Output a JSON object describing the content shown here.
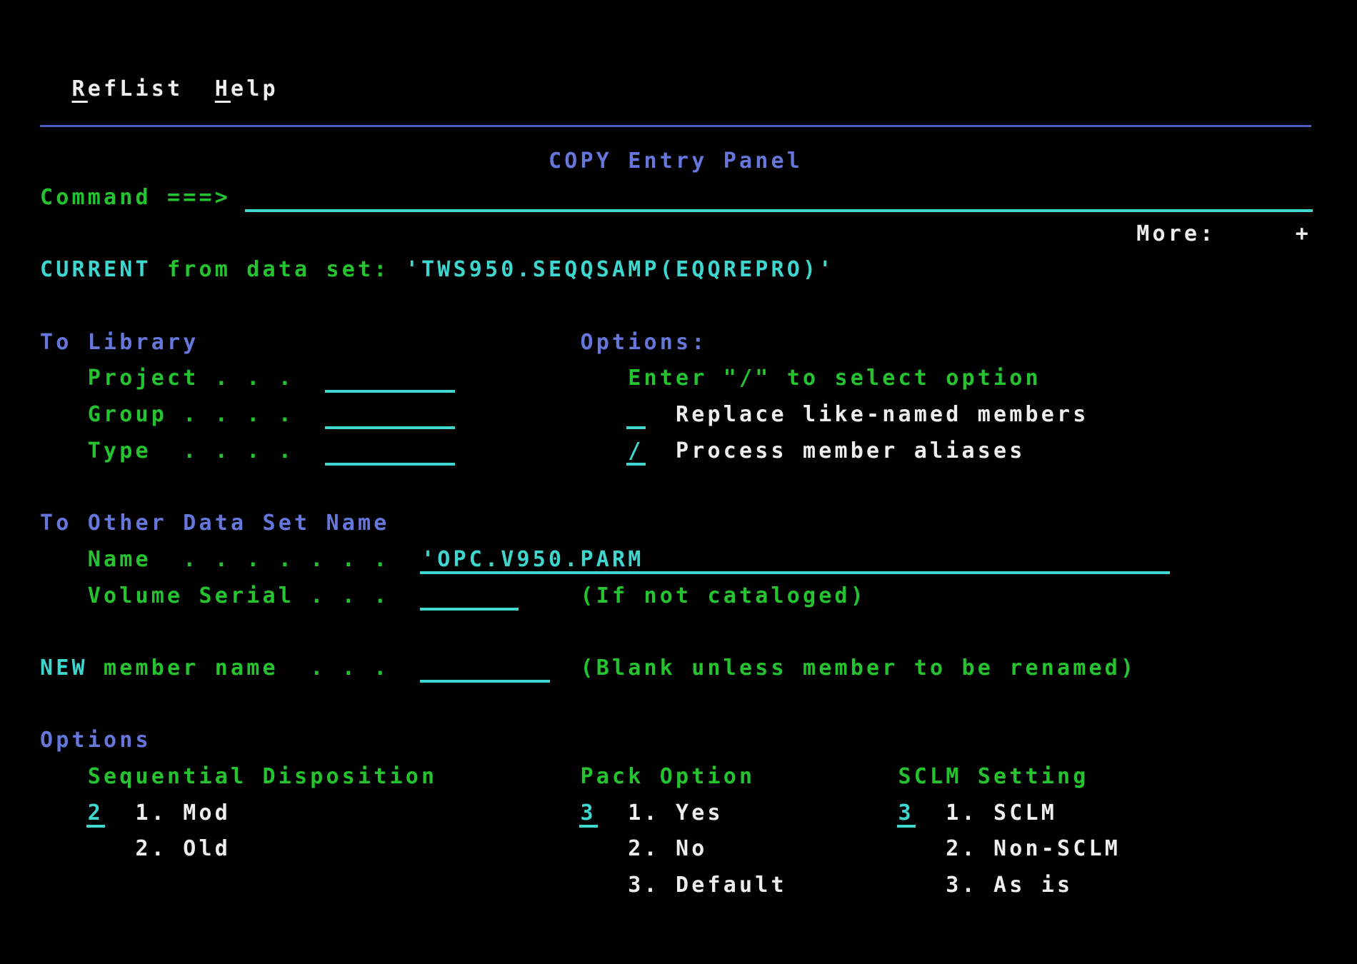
{
  "palette": {
    "background": "#000000",
    "green": "#25c32f",
    "cyan": "#40d6d0",
    "blue": "#6577da",
    "white": "#ededed",
    "divider_blue": "#4d5ec2"
  },
  "screen": {
    "rows": [
      {
        "r": 1,
        "segments": [
          {
            "col": 2,
            "color": "white",
            "name": "menu-reflist",
            "interactable": true,
            "u": "R",
            "rest": "efList"
          },
          {
            "col": 11,
            "color": "white",
            "name": "menu-help",
            "interactable": true,
            "u": "H",
            "rest": "elp"
          }
        ]
      },
      {
        "r": 3,
        "segments": [
          {
            "col": 32,
            "color": "blue",
            "name": "panel-title",
            "interactable": false,
            "text": "COPY Entry Panel"
          }
        ]
      },
      {
        "r": 4,
        "segments": [
          {
            "col": 0,
            "color": "green",
            "name": "command-label",
            "interactable": false,
            "text": "Command ===>"
          }
        ]
      },
      {
        "r": 5,
        "segments": [
          {
            "col": 69,
            "color": "white",
            "name": "more-indicator",
            "interactable": false,
            "text": "More:"
          },
          {
            "col": 79,
            "color": "white",
            "name": "more-plus",
            "interactable": true,
            "text": "+"
          }
        ]
      },
      {
        "r": 6,
        "segments": [
          {
            "col": 0,
            "color": "cyan",
            "name": "current-label",
            "interactable": false,
            "text": "CURRENT"
          },
          {
            "col": 8,
            "color": "green",
            "name": "from-dataset-label",
            "interactable": false,
            "text": "from data set:"
          },
          {
            "col": 23,
            "color": "cyan",
            "name": "current-dataset-value",
            "interactable": false,
            "text": "'TWS950.SEQQSAMP(EQQREPRO)'"
          }
        ]
      },
      {
        "r": 8,
        "segments": [
          {
            "col": 0,
            "color": "blue",
            "name": "to-library-heading",
            "interactable": false,
            "text": "To Library"
          },
          {
            "col": 34,
            "color": "blue",
            "name": "options-heading",
            "interactable": false,
            "text": "Options:"
          }
        ]
      },
      {
        "r": 9,
        "segments": [
          {
            "col": 3,
            "color": "green",
            "name": "project-label",
            "interactable": false,
            "text": "Project . . ."
          },
          {
            "col": 37,
            "color": "green",
            "name": "select-option-hint",
            "interactable": false,
            "text": "Enter \"/\" to select option"
          }
        ]
      },
      {
        "r": 10,
        "segments": [
          {
            "col": 3,
            "color": "green",
            "name": "group-label",
            "interactable": false,
            "text": "Group . . . ."
          },
          {
            "col": 40,
            "color": "white",
            "name": "replace-option-label",
            "interactable": false,
            "text": "Replace like-named members"
          }
        ]
      },
      {
        "r": 11,
        "segments": [
          {
            "col": 3,
            "color": "green",
            "name": "type-label",
            "interactable": false,
            "text": "Type  . . . ."
          },
          {
            "col": 40,
            "color": "white",
            "name": "aliases-option-label",
            "interactable": false,
            "text": "Process member aliases"
          }
        ]
      },
      {
        "r": 13,
        "segments": [
          {
            "col": 0,
            "color": "blue",
            "name": "to-other-dataset-heading",
            "interactable": false,
            "text": "To Other Data Set Name"
          }
        ]
      },
      {
        "r": 14,
        "segments": [
          {
            "col": 3,
            "color": "green",
            "name": "name-label",
            "interactable": false,
            "text": "Name  . . . . . . ."
          }
        ]
      },
      {
        "r": 15,
        "segments": [
          {
            "col": 3,
            "color": "green",
            "name": "volume-serial-label",
            "interactable": false,
            "text": "Volume Serial . . ."
          },
          {
            "col": 34,
            "color": "green",
            "name": "if-not-cataloged-note",
            "interactable": false,
            "text": "(If not cataloged)"
          }
        ]
      },
      {
        "r": 17,
        "segments": [
          {
            "col": 0,
            "color": "cyan",
            "name": "new-label",
            "interactable": false,
            "text": "NEW"
          },
          {
            "col": 4,
            "color": "green",
            "name": "member-name-label",
            "interactable": false,
            "text": "member name  . . ."
          },
          {
            "col": 34,
            "color": "green",
            "name": "rename-note",
            "interactable": false,
            "text": "(Blank unless member to be renamed)"
          }
        ]
      },
      {
        "r": 19,
        "segments": [
          {
            "col": 0,
            "color": "blue",
            "name": "options-section-heading",
            "interactable": false,
            "text": "Options"
          }
        ]
      },
      {
        "r": 20,
        "segments": [
          {
            "col": 3,
            "color": "green",
            "name": "sequential-disposition-label",
            "interactable": false,
            "text": "Sequential Disposition"
          },
          {
            "col": 34,
            "color": "green",
            "name": "pack-option-label",
            "interactable": false,
            "text": "Pack Option"
          },
          {
            "col": 54,
            "color": "green",
            "name": "sclm-setting-label",
            "interactable": false,
            "text": "SCLM Setting"
          }
        ]
      },
      {
        "r": 21,
        "segments": [
          {
            "col": 6,
            "color": "white",
            "name": "seq-disp-choice-1",
            "interactable": false,
            "text": "1. Mod"
          },
          {
            "col": 37,
            "color": "white",
            "name": "pack-choice-1",
            "interactable": false,
            "text": "1. Yes"
          },
          {
            "col": 57,
            "color": "white",
            "name": "sclm-choice-1",
            "interactable": false,
            "text": "1. SCLM"
          }
        ]
      },
      {
        "r": 22,
        "segments": [
          {
            "col": 6,
            "color": "white",
            "name": "seq-disp-choice-2",
            "interactable": false,
            "text": "2. Old"
          },
          {
            "col": 37,
            "color": "white",
            "name": "pack-choice-2",
            "interactable": false,
            "text": "2. No"
          },
          {
            "col": 57,
            "color": "white",
            "name": "sclm-choice-2",
            "interactable": false,
            "text": "2. Non-SCLM"
          }
        ]
      },
      {
        "r": 23,
        "segments": [
          {
            "col": 37,
            "color": "white",
            "name": "pack-choice-3",
            "interactable": false,
            "text": "3. Default"
          },
          {
            "col": 57,
            "color": "white",
            "name": "sclm-choice-3",
            "interactable": false,
            "text": "3. As is"
          }
        ]
      }
    ],
    "fields": [
      {
        "r": 4,
        "col": 13,
        "width": 67,
        "text": "",
        "name": "command-input"
      },
      {
        "r": 9,
        "col": 18,
        "width": 8,
        "text": "",
        "name": "project-input"
      },
      {
        "r": 10,
        "col": 18,
        "width": 8,
        "text": "",
        "name": "group-input"
      },
      {
        "r": 11,
        "col": 18,
        "width": 8,
        "text": "",
        "name": "type-input"
      },
      {
        "r": 10,
        "col": 37,
        "width": 1,
        "text": "",
        "name": "replace-members-input"
      },
      {
        "r": 11,
        "col": 37,
        "width": 1,
        "text": "/",
        "name": "process-aliases-input"
      },
      {
        "r": 14,
        "col": 24,
        "width": 47,
        "text": "'OPC.V950.PARM",
        "name": "dataset-name-input"
      },
      {
        "r": 15,
        "col": 24,
        "width": 6,
        "text": "",
        "name": "volume-serial-input"
      },
      {
        "r": 17,
        "col": 24,
        "width": 8,
        "text": "",
        "name": "new-member-name-input"
      },
      {
        "r": 21,
        "col": 3,
        "width": 1,
        "text": "2",
        "name": "sequential-disposition-input"
      },
      {
        "r": 21,
        "col": 34,
        "width": 1,
        "text": "3",
        "name": "pack-option-input"
      },
      {
        "r": 21,
        "col": 54,
        "width": 1,
        "text": "3",
        "name": "sclm-setting-input"
      }
    ]
  }
}
